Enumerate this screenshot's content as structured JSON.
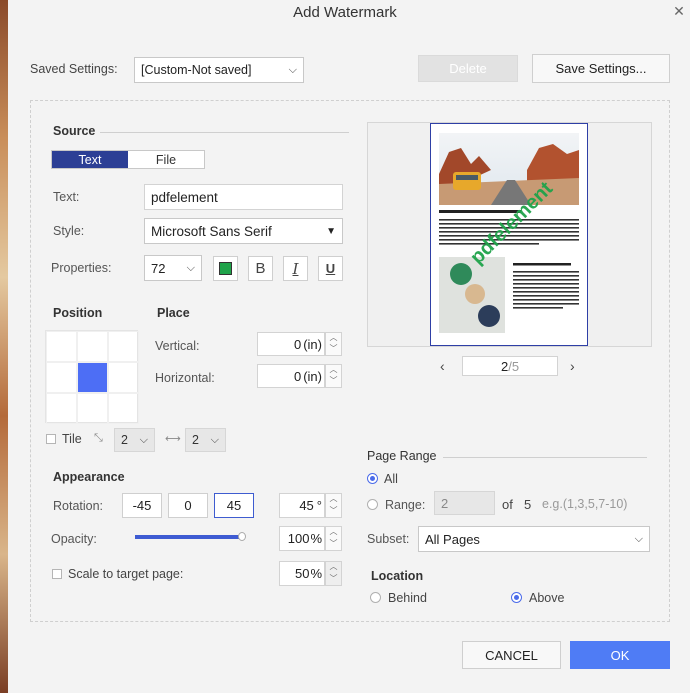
{
  "title": "Add Watermark",
  "saved_settings": {
    "label": "Saved Settings:",
    "value": "[Custom-Not saved]",
    "delete_label": "Delete",
    "save_label": "Save Settings..."
  },
  "source": {
    "title": "Source",
    "tabs": [
      "Text",
      "File"
    ],
    "text_label": "Text:",
    "text_value": "pdfelement",
    "style_label": "Style:",
    "style_value": "Microsoft Sans Serif",
    "properties_label": "Properties:",
    "font_size": "72",
    "color": "#1fa34a",
    "bold": "B",
    "italic": "I",
    "underline": "U"
  },
  "position": {
    "title": "Position",
    "selected_cell": 4,
    "place_title": "Place",
    "vertical_label": "Vertical:",
    "vertical_value": "0",
    "vertical_unit": "(in)",
    "horizontal_label": "Horizontal:",
    "horizontal_value": "0",
    "horizontal_unit": "(in)",
    "tile_label": "Tile",
    "tile_rows": "2",
    "tile_cols": "2"
  },
  "appearance": {
    "title": "Appearance",
    "rotation_label": "Rotation:",
    "rotation_presets": [
      "-45",
      "0",
      "45"
    ],
    "rotation_value": "45",
    "rotation_unit": "°",
    "opacity_label": "Opacity:",
    "opacity_percent": 100,
    "opacity_value": "100",
    "opacity_unit": "%",
    "scale_label": "Scale to target page:",
    "scale_value": "50",
    "scale_unit": "%"
  },
  "preview": {
    "page_current": "2",
    "page_sep": "/",
    "page_total": "5",
    "watermark_text": "pdfelement",
    "heading1": "IMPROVE SOCIAL LIFE AND CONFIDENCE OF USERS",
    "heading2": "INCREASE YOUR CONFIDENCE"
  },
  "page_range": {
    "title": "Page Range",
    "all_label": "All",
    "range_label": "Range:",
    "range_value": "2",
    "of_label": "of",
    "of_total": "5",
    "range_hint": "e.g.(1,3,5,7-10)",
    "subset_label": "Subset:",
    "subset_value": "All Pages"
  },
  "location": {
    "title": "Location",
    "behind_label": "Behind",
    "above_label": "Above",
    "selected": "above"
  },
  "footer": {
    "cancel_label": "CANCEL",
    "ok_label": "OK"
  }
}
